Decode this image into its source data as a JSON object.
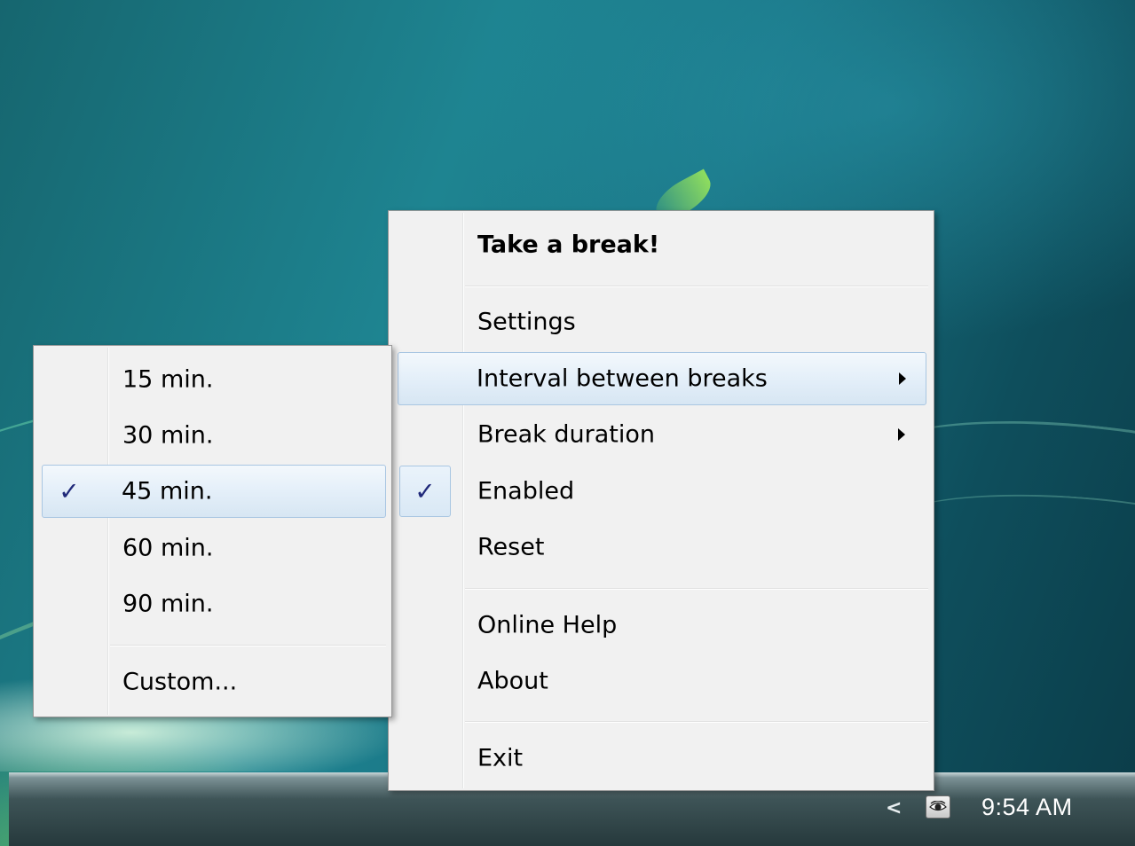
{
  "menu": {
    "title": "Take a break!",
    "items": [
      {
        "label": "Settings"
      },
      {
        "label": "Interval between breaks"
      },
      {
        "label": "Break duration"
      },
      {
        "label": "Enabled",
        "checked": true
      },
      {
        "label": "Reset"
      },
      {
        "label": "Online Help"
      },
      {
        "label": "About"
      },
      {
        "label": "Exit"
      }
    ]
  },
  "submenu": {
    "items": [
      {
        "label": "15 min."
      },
      {
        "label": "30 min."
      },
      {
        "label": "45 min.",
        "checked": true
      },
      {
        "label": "60 min."
      },
      {
        "label": "90 min."
      },
      {
        "label": "Custom..."
      }
    ]
  },
  "check_glyph": "✓",
  "taskbar": {
    "chevron": "<",
    "clock": "9:54 AM",
    "tray_icon": "eye-icon"
  },
  "colors": {
    "menu_bg": "#f1f1f1",
    "highlight_border": "#a9c6e2",
    "check": "#20297a"
  }
}
